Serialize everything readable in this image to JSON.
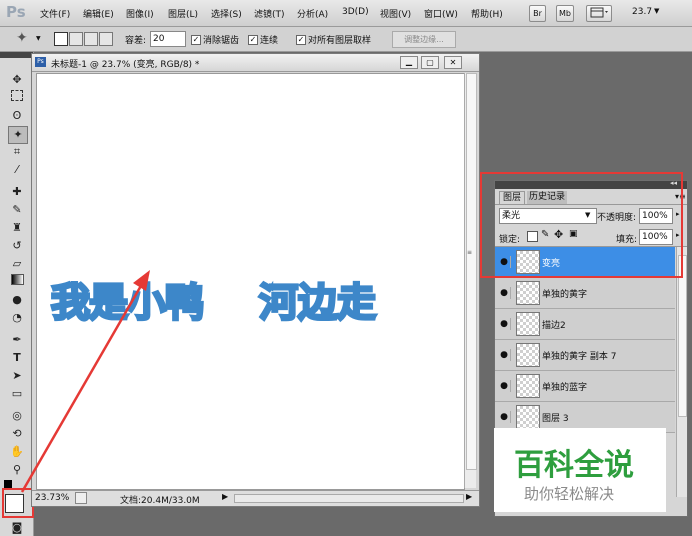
{
  "app": {
    "logo": "Ps"
  },
  "menubar": {
    "items": [
      "文件(F)",
      "编辑(E)",
      "图像(I)",
      "图层(L)",
      "选择(S)",
      "滤镜(T)",
      "分析(A)",
      "3D(D)",
      "视图(V)",
      "窗口(W)",
      "帮助(H)"
    ],
    "buttons": [
      "Br",
      "Mb"
    ],
    "zoom": "23.7"
  },
  "options": {
    "tolerance_label": "容差:",
    "tolerance_value": "20",
    "anti_alias": "消除锯齿",
    "contiguous": "连续",
    "sample_all": "对所有图层取样",
    "refine_edge": "调整边缘..."
  },
  "document": {
    "title": "未标题-1 @ 23.7% (变亮, RGB/8) *",
    "canvas_text_left": "我是小鸭",
    "canvas_text_right": "河边走",
    "zoom": "23.73%",
    "doc_size": "文档:20.4M/33.0M"
  },
  "layers_panel": {
    "tabs": [
      "图层",
      "历史记录"
    ],
    "blend_mode": "柔光",
    "opacity_label": "不透明度:",
    "opacity": "100%",
    "lock_label": "锁定:",
    "fill_label": "填充:",
    "fill": "100%",
    "layers": [
      {
        "name": "变亮",
        "selected": true
      },
      {
        "name": "单独的黄字",
        "selected": false
      },
      {
        "name": "描边2",
        "selected": false
      },
      {
        "name": "单独的黄字 副本 7",
        "selected": false
      },
      {
        "name": "单独的蓝字",
        "selected": false
      },
      {
        "name": "图层 3",
        "selected": false
      }
    ]
  },
  "watermark": {
    "title": "百科全说",
    "subtitle": "助你轻松解决"
  },
  "colors": {
    "highlight_box": "#e53935",
    "selected_layer": "#3d8ee6",
    "arrow": "#e53935",
    "watermark_green": "#2e9e3e"
  }
}
